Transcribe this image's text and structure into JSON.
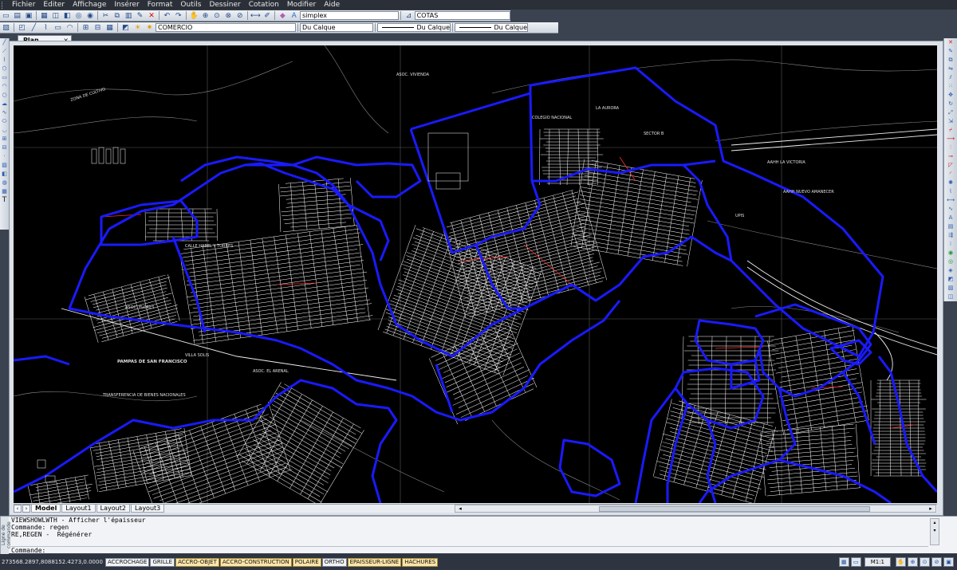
{
  "menubar": {
    "items": [
      "Fichier",
      "Editer",
      "Affichage",
      "Insérer",
      "Format",
      "Outils",
      "Dessiner",
      "Cotation",
      "Modifier",
      "Aide"
    ]
  },
  "toolbar": {
    "text_style": "simplex",
    "dim_style": "COTAS",
    "layer": "COMERCIO",
    "color": "Du Calque",
    "linetype": "Du Calque",
    "lineweight": "Du Calque"
  },
  "document": {
    "tab_title": "Plan cité.dwg*",
    "close_glyph": "×"
  },
  "layout_tabs": [
    "Model",
    "Layout1",
    "Layout2",
    "Layout3"
  ],
  "map": {
    "labels": [
      "PAMPAS DE SAN FRANCISCO",
      "TRANSFERENCIA DE BIENES NACIONALES",
      "COLEGIO NACIONAL",
      "ASOC. VIVIENDA",
      "AAHH LA VICTORIA",
      "VILLA SOLIS",
      "CALLE HABEL Y TORRES",
      "ASOC. EL ARENAL",
      "ZONA DE CULTIVO",
      "UPIS",
      "SECTOR B",
      "AAHH NUEVO AMANECER",
      "LA AURORA",
      "ASOC. FLORES"
    ]
  },
  "command": {
    "history": [
      "VIEWSHOWLWTH - Afficher l'épaisseur",
      "Commande: regen",
      "RE,REGEN -  Régénérer"
    ],
    "prompt": "Commande:",
    "side_label": "Ligne de commande"
  },
  "status": {
    "coordinates": "273568.2897,8088152.4273,0.0000",
    "buttons": [
      {
        "label": "ACCROCHAGE",
        "on": false
      },
      {
        "label": "GRILLE",
        "on": false
      },
      {
        "label": "ACCRO-OBJET",
        "on": true
      },
      {
        "label": "ACCRO-CONSTRUCTION",
        "on": true
      },
      {
        "label": "POLAIRE",
        "on": true
      },
      {
        "label": "ORTHO",
        "on": false
      },
      {
        "label": "EPAISSEUR-LIGNE",
        "on": true
      },
      {
        "label": "HACHURES",
        "on": true
      }
    ],
    "scale": "M1:1"
  },
  "colors": {
    "zone_boundary": "#1a1aff",
    "streets": "#ffffff",
    "highlight": "#ff2a2a",
    "accent": "#fbe6a8"
  },
  "icons": [
    "new-icon",
    "open-icon",
    "save-icon",
    "print-icon",
    "cut-icon",
    "copy-icon",
    "paste-icon",
    "undo-icon",
    "redo-icon",
    "erase-icon",
    "zoom-icon",
    "pan-icon",
    "layer-icon",
    "properties-icon",
    "close-icon",
    "line-icon",
    "circle-icon",
    "arc-icon",
    "text-icon"
  ]
}
